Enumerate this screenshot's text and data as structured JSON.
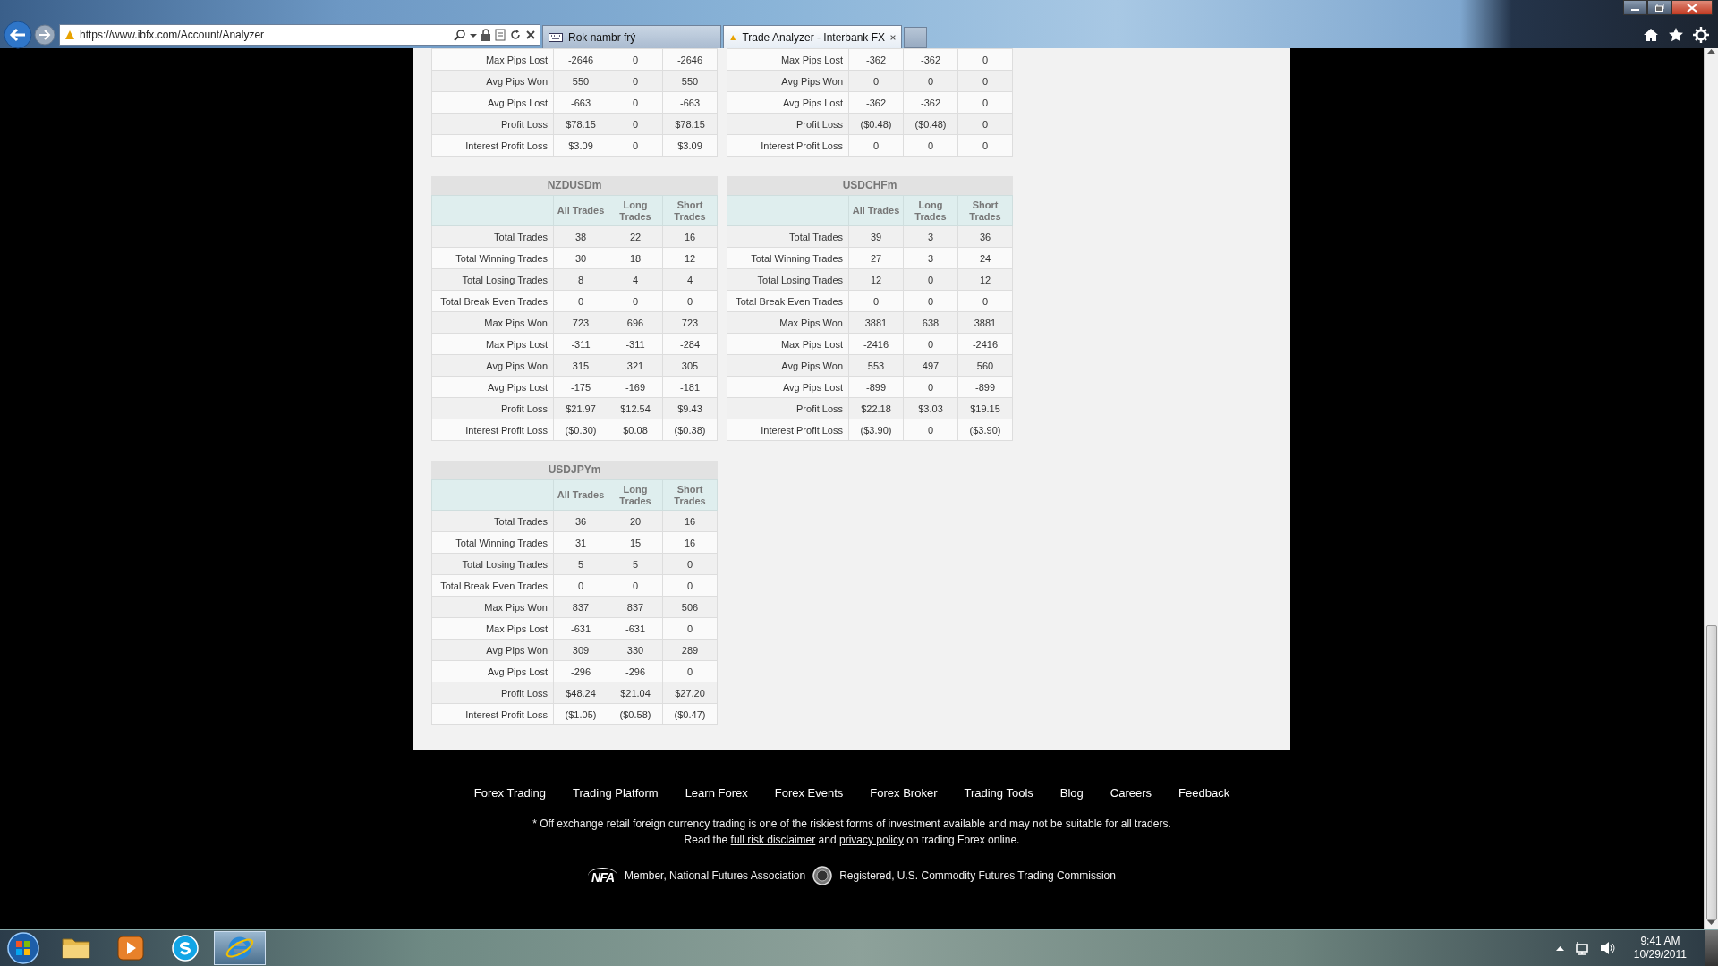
{
  "browser": {
    "url": "https://www.ibfx.com/Account/Analyzer",
    "tabs": [
      {
        "label": "Rok nambr frý",
        "selected": false
      },
      {
        "label": "Trade Analyzer - Interbank FX",
        "selected": true
      }
    ]
  },
  "tables": [
    {
      "rows": [
        [
          "Max Pips Lost",
          "-2646",
          "0",
          "-2646"
        ],
        [
          "Avg Pips Won",
          "550",
          "0",
          "550"
        ],
        [
          "Avg Pips Lost",
          "-663",
          "0",
          "-663"
        ],
        [
          "Profit Loss",
          "$78.15",
          "0",
          "$78.15"
        ],
        [
          "Interest Profit Loss",
          "$3.09",
          "0",
          "$3.09"
        ]
      ]
    },
    {
      "rows": [
        [
          "Max Pips Lost",
          "-362",
          "-362",
          "0"
        ],
        [
          "Avg Pips Won",
          "0",
          "0",
          "0"
        ],
        [
          "Avg Pips Lost",
          "-362",
          "-362",
          "0"
        ],
        [
          "Profit Loss",
          "($0.48)",
          "($0.48)",
          "0"
        ],
        [
          "Interest Profit Loss",
          "0",
          "0",
          "0"
        ]
      ]
    },
    {
      "title": "NZDUSDm",
      "columns": [
        "",
        "All Trades",
        "Long Trades",
        "Short Trades"
      ],
      "rows": [
        [
          "Total Trades",
          "38",
          "22",
          "16"
        ],
        [
          "Total Winning Trades",
          "30",
          "18",
          "12"
        ],
        [
          "Total Losing Trades",
          "8",
          "4",
          "4"
        ],
        [
          "Total Break Even Trades",
          "0",
          "0",
          "0"
        ],
        [
          "Max Pips Won",
          "723",
          "696",
          "723"
        ],
        [
          "Max Pips Lost",
          "-311",
          "-311",
          "-284"
        ],
        [
          "Avg Pips Won",
          "315",
          "321",
          "305"
        ],
        [
          "Avg Pips Lost",
          "-175",
          "-169",
          "-181"
        ],
        [
          "Profit Loss",
          "$21.97",
          "$12.54",
          "$9.43"
        ],
        [
          "Interest Profit Loss",
          "($0.30)",
          "$0.08",
          "($0.38)"
        ]
      ]
    },
    {
      "title": "USDCHFm",
      "columns": [
        "",
        "All Trades",
        "Long Trades",
        "Short Trades"
      ],
      "rows": [
        [
          "Total Trades",
          "39",
          "3",
          "36"
        ],
        [
          "Total Winning Trades",
          "27",
          "3",
          "24"
        ],
        [
          "Total Losing Trades",
          "12",
          "0",
          "12"
        ],
        [
          "Total Break Even Trades",
          "0",
          "0",
          "0"
        ],
        [
          "Max Pips Won",
          "3881",
          "638",
          "3881"
        ],
        [
          "Max Pips Lost",
          "-2416",
          "0",
          "-2416"
        ],
        [
          "Avg Pips Won",
          "553",
          "497",
          "560"
        ],
        [
          "Avg Pips Lost",
          "-899",
          "0",
          "-899"
        ],
        [
          "Profit Loss",
          "$22.18",
          "$3.03",
          "$19.15"
        ],
        [
          "Interest Profit Loss",
          "($3.90)",
          "0",
          "($3.90)"
        ]
      ]
    },
    {
      "title": "USDJPYm",
      "columns": [
        "",
        "All Trades",
        "Long Trades",
        "Short Trades"
      ],
      "rows": [
        [
          "Total Trades",
          "36",
          "20",
          "16"
        ],
        [
          "Total Winning Trades",
          "31",
          "15",
          "16"
        ],
        [
          "Total Losing Trades",
          "5",
          "5",
          "0"
        ],
        [
          "Total Break Even Trades",
          "0",
          "0",
          "0"
        ],
        [
          "Max Pips Won",
          "837",
          "837",
          "506"
        ],
        [
          "Max Pips Lost",
          "-631",
          "-631",
          "0"
        ],
        [
          "Avg Pips Won",
          "309",
          "330",
          "289"
        ],
        [
          "Avg Pips Lost",
          "-296",
          "-296",
          "0"
        ],
        [
          "Profit Loss",
          "$48.24",
          "$21.04",
          "$27.20"
        ],
        [
          "Interest Profit Loss",
          "($1.05)",
          "($0.58)",
          "($0.47)"
        ]
      ]
    }
  ],
  "footer": {
    "links": [
      "Forex Trading",
      "Trading Platform",
      "Learn Forex",
      "Forex Events",
      "Forex Broker",
      "Trading Tools",
      "Blog",
      "Careers",
      "Feedback"
    ],
    "disclaimer": "* Off exchange retail foreign currency trading is one of the riskiest forms of investment available and may not be suitable for all traders.",
    "read_line": {
      "before": "Read the",
      "link_1": "full risk disclaimer",
      "middle": "and",
      "link_2": "privacy policy",
      "after": "on trading Forex online."
    },
    "nfa_logo": "NFA",
    "nfa_text": "Member, National Futures Association",
    "cftc_text": "Registered, U.S. Commodity Futures Trading Commission"
  },
  "taskbar": {
    "items": [
      {
        "kind": "folder",
        "selected": false
      },
      {
        "kind": "media",
        "selected": false
      },
      {
        "kind": "skype",
        "selected": false
      },
      {
        "kind": "ie",
        "selected": true
      }
    ],
    "time": "9:41 AM",
    "date": "10/29/2011"
  }
}
